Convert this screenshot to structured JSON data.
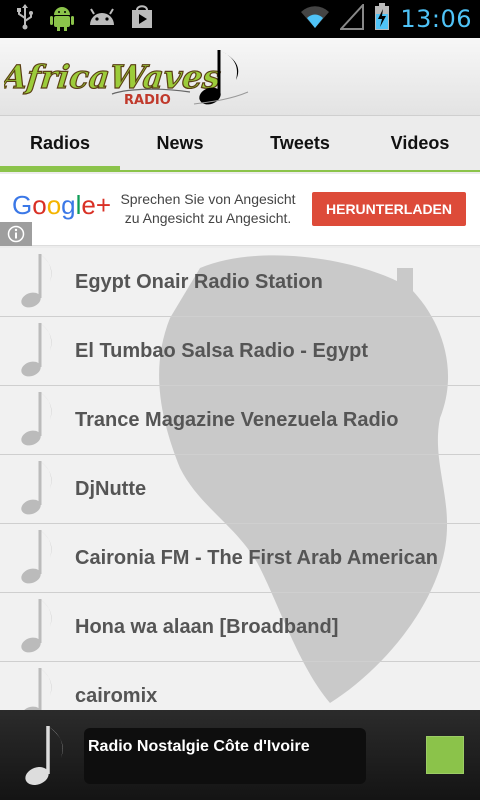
{
  "status_bar": {
    "time": "13:06",
    "icons": [
      "usb-icon",
      "android-debug-icon",
      "android-icon",
      "play-store-icon",
      "wifi-icon",
      "signal-icon",
      "battery-charging-icon"
    ]
  },
  "header": {
    "logo_text": "AfricaWaves",
    "logo_subtext": "RADIO"
  },
  "tabs": [
    {
      "label": "Radios",
      "active": true
    },
    {
      "label": "News",
      "active": false
    },
    {
      "label": "Tweets",
      "active": false
    },
    {
      "label": "Videos",
      "active": false
    }
  ],
  "ad": {
    "logo": "Google+",
    "text_line1": "Sprechen Sie von Angesicht",
    "text_line2": "zu Angesicht zu Angesicht.",
    "button": "HERUNTERLADEN"
  },
  "radios": [
    "Egypt Onair Radio Station",
    "El Tumbao Salsa Radio - Egypt",
    "Trance Magazine Venezuela Radio",
    "DjNutte",
    "Caironia FM - The First Arab American",
    "Hona wa alaan [Broadband]",
    "cairomix"
  ],
  "player": {
    "now_playing": "Radio Nostalgie Côte d'Ivoire"
  },
  "colors": {
    "accent": "#8bc34a",
    "clock": "#4fc3f7",
    "ad_button": "#dd4b39"
  }
}
